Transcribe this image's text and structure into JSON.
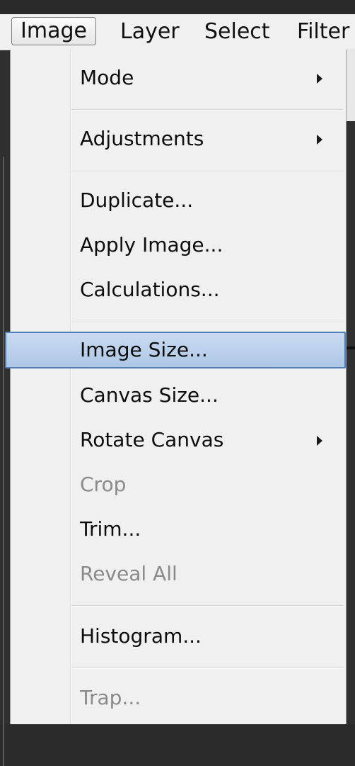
{
  "menubar": {
    "items": [
      {
        "label": "Image",
        "active": true
      },
      {
        "label": "Layer",
        "active": false
      },
      {
        "label": "Select",
        "active": false
      },
      {
        "label": "Filter",
        "active": false
      }
    ]
  },
  "image_menu": {
    "items": [
      {
        "label": "Mode",
        "submenu": true,
        "enabled": true
      },
      {
        "label": "Adjustments",
        "submenu": true,
        "enabled": true
      },
      {
        "label": "Duplicate...",
        "submenu": false,
        "enabled": true
      },
      {
        "label": "Apply Image...",
        "submenu": false,
        "enabled": true
      },
      {
        "label": "Calculations...",
        "submenu": false,
        "enabled": true
      },
      {
        "label": "Image Size...",
        "submenu": false,
        "enabled": true,
        "highlighted": true
      },
      {
        "label": "Canvas Size...",
        "submenu": false,
        "enabled": true
      },
      {
        "label": "Rotate Canvas",
        "submenu": true,
        "enabled": true
      },
      {
        "label": "Crop",
        "submenu": false,
        "enabled": false
      },
      {
        "label": "Trim...",
        "submenu": false,
        "enabled": true
      },
      {
        "label": "Reveal All",
        "submenu": false,
        "enabled": false
      },
      {
        "label": "Histogram...",
        "submenu": false,
        "enabled": true
      },
      {
        "label": "Trap...",
        "submenu": false,
        "enabled": false
      }
    ]
  },
  "colors": {
    "menu_bg": "#f0f0f0",
    "highlight": "#b8cfea",
    "highlight_border": "#4f7fb8",
    "disabled_text": "#8a8a8a"
  }
}
